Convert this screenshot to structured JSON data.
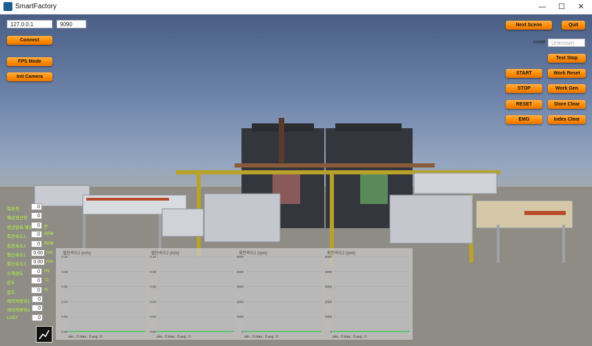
{
  "window": {
    "title": "SmartFactory",
    "minimize": "—",
    "maximize": "☐",
    "close": "✕"
  },
  "connection": {
    "ip": "127.0.0.1",
    "port": "9090",
    "connect_label": "Connect"
  },
  "left_buttons": {
    "fps_mode": "FPS Mode",
    "init_camera": "Init Camera"
  },
  "top_right": {
    "next_scene": "Next Scene",
    "quit": "Quit",
    "mode_label": "mode",
    "mode_placeholder": "Unknown"
  },
  "control_buttons": {
    "test_stop": "Test Stop",
    "start": "START",
    "work_reset": "Work Reset",
    "stop": "STOP",
    "work_gen": "Work Gen",
    "reset": "RESET",
    "store_clear": "Store Clear",
    "emg": "EMG",
    "index_clear": "Index Clear"
  },
  "sensors": [
    {
      "label": "목표량",
      "value": "0",
      "unit": ""
    },
    {
      "label": "예상생산량",
      "value": "0",
      "unit": ""
    },
    {
      "label": "생산완료 예상시간",
      "value": "0",
      "unit": "분"
    },
    {
      "label": "회전속도1",
      "value": "0",
      "unit": "RPM"
    },
    {
      "label": "회전속도2",
      "value": "0",
      "unit": "RPM"
    },
    {
      "label": "절단속도1",
      "value": "0.00",
      "unit": "m/s"
    },
    {
      "label": "절단속도2",
      "value": "0.00",
      "unit": "m/s"
    },
    {
      "label": "소재경도",
      "value": "0",
      "unit": "HV"
    },
    {
      "label": "온도",
      "value": "0",
      "unit": "°C"
    },
    {
      "label": "습도",
      "value": "0",
      "unit": "%"
    },
    {
      "label": "레이저변위1",
      "value": "0",
      "unit": ""
    },
    {
      "label": "레이저변위2",
      "value": "0",
      "unit": ""
    },
    {
      "label": "LVDT",
      "value": "0",
      "unit": ""
    }
  ],
  "charts_text": [
    {
      "title": "절단속도1 (m/s)",
      "yticks": [
        "0.10",
        "0.08",
        "0.06",
        "0.04",
        "0.02",
        "0.00"
      ],
      "stats": "min : 0    max : 0    avg : 0"
    },
    {
      "title": "절단속도2 (m/s)",
      "yticks": [
        "0.10",
        "0.08",
        "0.06",
        "0.04",
        "0.02",
        "0.00"
      ],
      "stats": "min : 0    max : 0    avg : 0"
    },
    {
      "title": "회전속도1 (rpm)",
      "yticks": [
        "5000",
        "4000",
        "3000",
        "2000",
        "1000",
        "0"
      ],
      "stats": "min : 0    max : 0    avg : 0"
    },
    {
      "title": "회전속도2 (rpm)",
      "yticks": [
        "5000",
        "4000",
        "3000",
        "2000",
        "1000",
        "0"
      ],
      "stats": "min : 0    max : 0    avg : 0"
    }
  ],
  "chart_data": [
    {
      "type": "line",
      "title": "절단속도1 (m/s)",
      "ylim": [
        0,
        0.1
      ],
      "series": [
        {
          "values": [
            0,
            0,
            0,
            0,
            0,
            0,
            0,
            0,
            0,
            0
          ]
        }
      ]
    },
    {
      "type": "line",
      "title": "절단속도2 (m/s)",
      "ylim": [
        0,
        0.1
      ],
      "series": [
        {
          "values": [
            0,
            0,
            0,
            0,
            0,
            0,
            0,
            0,
            0,
            0
          ]
        }
      ]
    },
    {
      "type": "line",
      "title": "회전속도1 (rpm)",
      "ylim": [
        0,
        5000
      ],
      "series": [
        {
          "values": [
            0,
            0,
            0,
            0,
            0,
            0,
            0,
            0,
            0,
            0
          ]
        }
      ]
    },
    {
      "type": "line",
      "title": "회전속도2 (rpm)",
      "ylim": [
        0,
        5000
      ],
      "series": [
        {
          "values": [
            0,
            0,
            0,
            0,
            0,
            0,
            0,
            0,
            0,
            0
          ]
        }
      ]
    }
  ],
  "colors": {
    "accent": "#ff8c00",
    "label_green": "#b4ff3c",
    "line_green": "#2ecc40"
  }
}
